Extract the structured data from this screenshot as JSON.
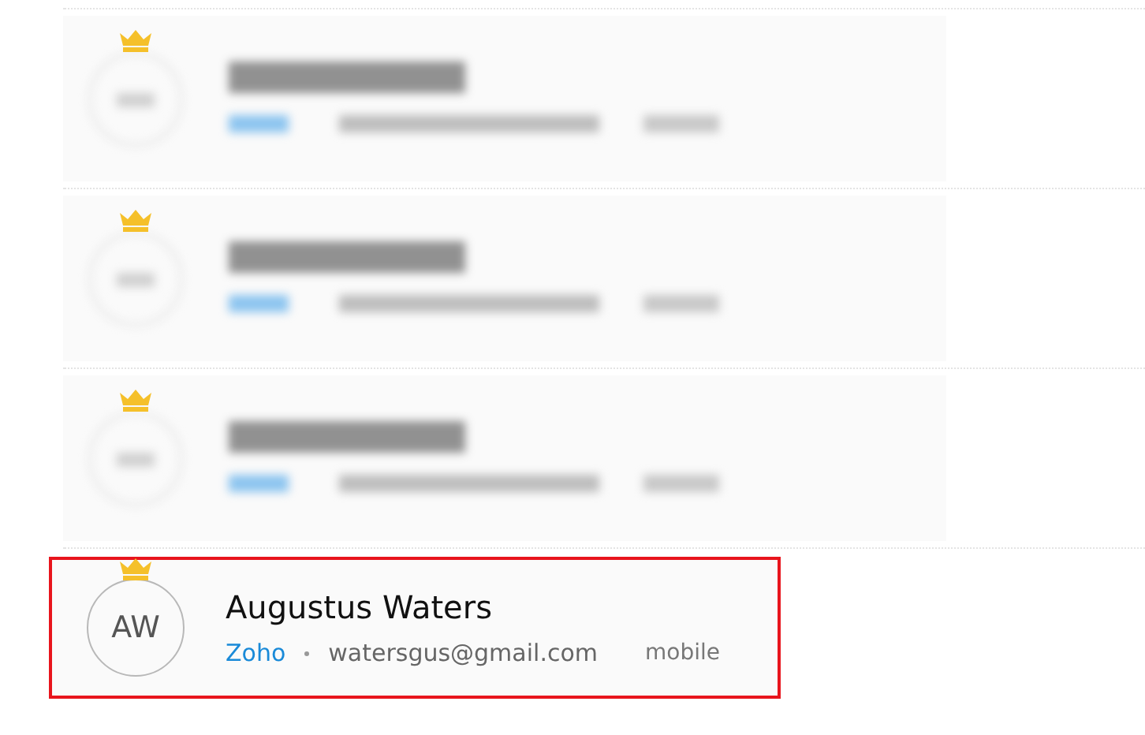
{
  "contacts": [
    {
      "kind": "redacted",
      "crowned": true,
      "highlighted": false
    },
    {
      "kind": "redacted",
      "crowned": true,
      "highlighted": false
    },
    {
      "kind": "redacted",
      "crowned": true,
      "highlighted": false
    },
    {
      "kind": "contact",
      "initials": "AW",
      "name": "Augustus Waters",
      "company": "Zoho",
      "email": "watersgus@gmail.com",
      "phone_type": "mobile",
      "crowned": true,
      "highlighted": true
    }
  ]
}
